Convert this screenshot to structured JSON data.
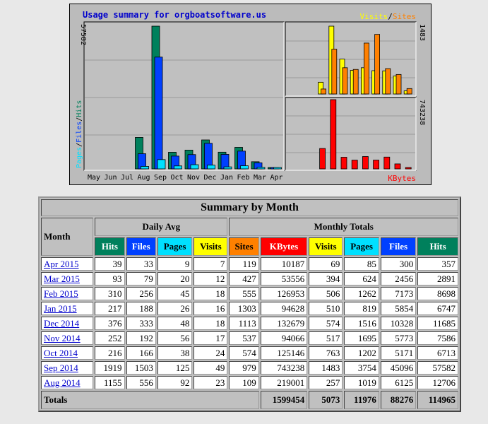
{
  "chart_data": {
    "type": "bar",
    "title": "Usage summary for orgboatsoftware.us",
    "months": [
      "May",
      "Jun",
      "Jul",
      "Aug",
      "Sep",
      "Oct",
      "Nov",
      "Dec",
      "Jan",
      "Feb",
      "Mar",
      "Apr"
    ],
    "left_axis_label_parts": [
      "Pages",
      "/",
      "Files",
      "/",
      "Hits"
    ],
    "left_axis_max": "57582",
    "visits_sites_legend": [
      "Visits",
      "/",
      "Sites"
    ],
    "visits_sites_max": "1483",
    "kbytes_label": "KBytes",
    "kbytes_max": "743238",
    "series": [
      {
        "name": "Hits",
        "values": [
          0,
          0,
          0,
          12706,
          57582,
          6713,
          7586,
          11685,
          6747,
          8698,
          2891,
          357
        ]
      },
      {
        "name": "Files",
        "values": [
          0,
          0,
          0,
          6125,
          45096,
          5171,
          5773,
          10328,
          5854,
          7173,
          2456,
          300
        ]
      },
      {
        "name": "Pages",
        "values": [
          0,
          0,
          0,
          1019,
          3754,
          1202,
          1695,
          1516,
          819,
          1262,
          624,
          85
        ]
      },
      {
        "name": "Visits",
        "values": [
          0,
          0,
          0,
          257,
          1483,
          763,
          517,
          574,
          510,
          506,
          394,
          69
        ]
      },
      {
        "name": "Sites",
        "values": [
          0,
          0,
          0,
          109,
          979,
          574,
          537,
          1113,
          1303,
          555,
          427,
          119
        ]
      },
      {
        "name": "KBytes",
        "values": [
          0,
          0,
          0,
          219001,
          743238,
          125146,
          94066,
          132679,
          94628,
          126953,
          53556,
          10187
        ]
      }
    ],
    "colors": {
      "hits": "#00805c",
      "files": "#0040ff",
      "pages": "#00e0ff",
      "visits": "#ffff00",
      "sites": "#ff8000",
      "kbytes": "#ff0000"
    }
  },
  "table": {
    "title": "Summary by Month",
    "month_header": "Month",
    "daily_avg_header": "Daily Avg",
    "monthly_totals_header": "Monthly Totals",
    "daily_cols": [
      "Hits",
      "Files",
      "Pages",
      "Visits"
    ],
    "monthly_cols": [
      "Sites",
      "KBytes",
      "Visits",
      "Pages",
      "Files",
      "Hits"
    ],
    "rows": [
      {
        "month": "Apr 2015",
        "d": [
          "39",
          "33",
          "9",
          "7"
        ],
        "m": [
          "119",
          "10187",
          "69",
          "85",
          "300",
          "357"
        ]
      },
      {
        "month": "Mar 2015",
        "d": [
          "93",
          "79",
          "20",
          "12"
        ],
        "m": [
          "427",
          "53556",
          "394",
          "624",
          "2456",
          "2891"
        ]
      },
      {
        "month": "Feb 2015",
        "d": [
          "310",
          "256",
          "45",
          "18"
        ],
        "m": [
          "555",
          "126953",
          "506",
          "1262",
          "7173",
          "8698"
        ]
      },
      {
        "month": "Jan 2015",
        "d": [
          "217",
          "188",
          "26",
          "16"
        ],
        "m": [
          "1303",
          "94628",
          "510",
          "819",
          "5854",
          "6747"
        ]
      },
      {
        "month": "Dec 2014",
        "d": [
          "376",
          "333",
          "48",
          "18"
        ],
        "m": [
          "1113",
          "132679",
          "574",
          "1516",
          "10328",
          "11685"
        ]
      },
      {
        "month": "Nov 2014",
        "d": [
          "252",
          "192",
          "56",
          "17"
        ],
        "m": [
          "537",
          "94066",
          "517",
          "1695",
          "5773",
          "7586"
        ]
      },
      {
        "month": "Oct 2014",
        "d": [
          "216",
          "166",
          "38",
          "24"
        ],
        "m": [
          "574",
          "125146",
          "763",
          "1202",
          "5171",
          "6713"
        ]
      },
      {
        "month": "Sep 2014",
        "d": [
          "1919",
          "1503",
          "125",
          "49"
        ],
        "m": [
          "979",
          "743238",
          "1483",
          "3754",
          "45096",
          "57582"
        ]
      },
      {
        "month": "Aug 2014",
        "d": [
          "1155",
          "556",
          "92",
          "23"
        ],
        "m": [
          "109",
          "219001",
          "257",
          "1019",
          "6125",
          "12706"
        ]
      }
    ],
    "totals_label": "Totals",
    "totals": [
      "1599454",
      "5073",
      "11976",
      "88276",
      "114965"
    ]
  }
}
